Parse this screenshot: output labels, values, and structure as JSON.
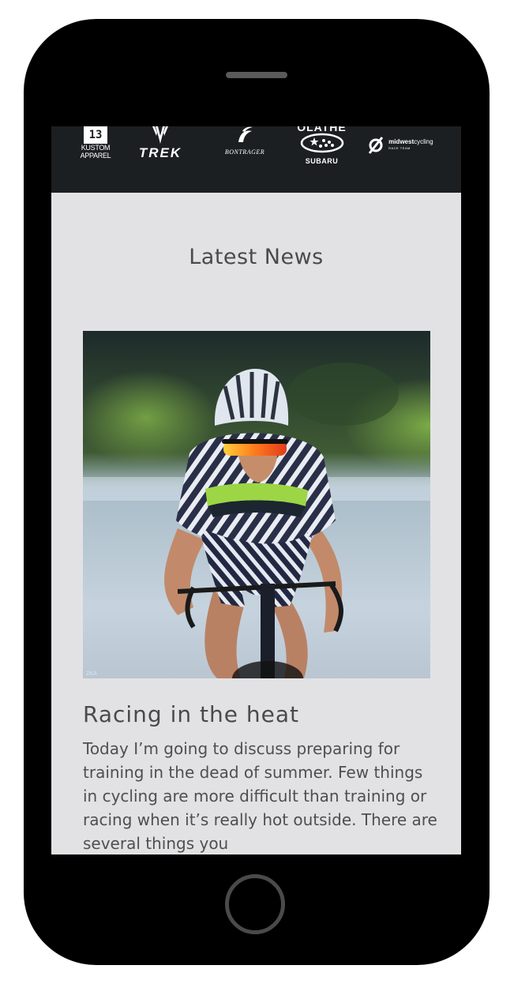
{
  "sponsors": {
    "kustom": {
      "badge": "13",
      "line1": "KUSTOM",
      "line2": "APPAREL"
    },
    "trek": {
      "name": "TREK"
    },
    "bontrager": {
      "name": "BONTRAGER"
    },
    "subaru": {
      "dealer": "OLATHE",
      "name": "SUBARU"
    },
    "midwest": {
      "name_bold": "midwest",
      "name_light": "cycling",
      "sub": "RACE TEAM"
    }
  },
  "news": {
    "heading": "Latest News",
    "article": {
      "title": "Racing in the heat",
      "excerpt": "Today I’m going to discuss preparing for training in the dead of summer. Few things in cycling are more difficult than training or racing when it’s really hot outside. There are several things you"
    }
  }
}
